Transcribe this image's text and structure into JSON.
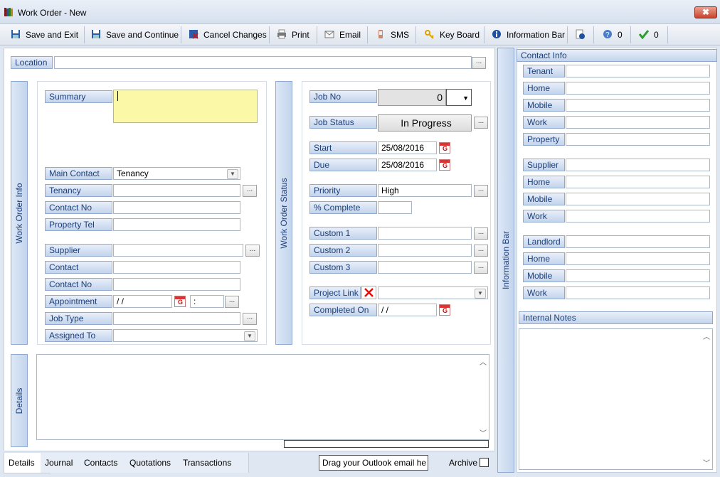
{
  "window": {
    "title": "Work Order -  New",
    "close_glyph": "✖"
  },
  "toolbar": {
    "save_exit": "Save and Exit",
    "save_continue": "Save and Continue",
    "cancel": "Cancel Changes",
    "print": "Print",
    "email": "Email",
    "sms": "SMS",
    "keyboard": "Key Board",
    "infobar": "Information Bar",
    "help_count": "0",
    "tick_count": "0"
  },
  "location": {
    "label": "Location",
    "value": ""
  },
  "work_order_info": {
    "tab_label": "Work Order Info",
    "summary_label": "Summary",
    "main_contact_label": "Main Contact",
    "main_contact_value": "Tenancy",
    "tenancy_label": "Tenancy",
    "contact_no_label": "Contact No",
    "property_tel_label": "Property Tel",
    "supplier_label": "Supplier",
    "contact_label": "Contact",
    "contact_no2_label": "Contact No",
    "appointment_label": "Appointment",
    "appointment_date": " / /",
    "appointment_time": " :",
    "job_type_label": "Job Type",
    "assigned_to_label": "Assigned To"
  },
  "work_order_status": {
    "tab_label": "Work Order Status",
    "job_no_label": "Job No",
    "job_no_value": "0",
    "job_status_label": "Job Status",
    "job_status_value": "In Progress",
    "start_label": "Start",
    "start_value": "25/08/2016",
    "due_label": "Due",
    "due_value": "25/08/2016",
    "priority_label": "Priority",
    "priority_value": "High",
    "complete_label": "% Complete",
    "custom1_label": "Custom 1",
    "custom2_label": "Custom 2",
    "custom3_label": "Custom 3",
    "project_link_label": "Project Link",
    "completed_on_label": "Completed On",
    "completed_on_value": " / /"
  },
  "details": {
    "tab_label": "Details"
  },
  "bottom_tabs": [
    "Details",
    "Journal",
    "Contacts",
    "Quotations",
    "Transactions"
  ],
  "outlook_drag": "Drag your Outlook email he",
  "archive_label": "Archive",
  "information_bar": {
    "label": "Information Bar"
  },
  "contact_info": {
    "header": "Contact Info",
    "tenant_group": [
      "Tenant",
      "Home",
      "Mobile",
      "Work",
      "Property"
    ],
    "supplier_group": [
      "Supplier",
      "Home",
      "Mobile",
      "Work"
    ],
    "landlord_group": [
      "Landlord",
      "Home",
      "Mobile",
      "Work"
    ]
  },
  "internal_notes": {
    "header": "Internal Notes"
  },
  "colors": {
    "accent": "#1d3f7a",
    "label_bg": "#c3d4ec",
    "summary_bg": "#fbf8a8"
  }
}
